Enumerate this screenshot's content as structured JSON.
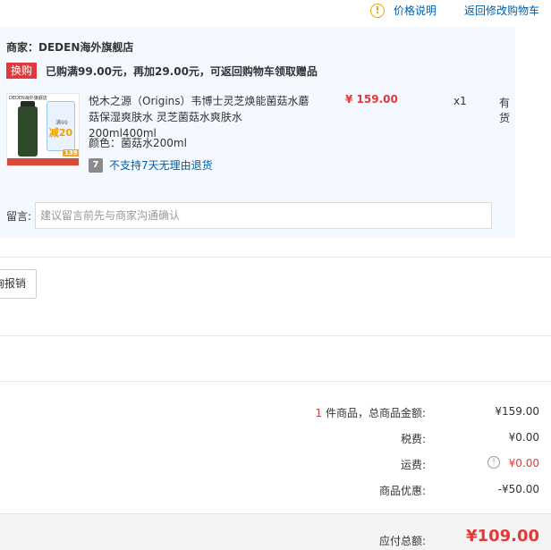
{
  "header": {
    "price_note": "价格说明",
    "back_link": "返回修改购物车"
  },
  "shop": {
    "name": "商家：DEDEN海外旗舰店",
    "promo_tag": "换购",
    "promo_text": "已购满99.00元，再加29.00元，可返回购物车领取赠品"
  },
  "product": {
    "title": "悦木之源（Origins）韦博士灵芝焕能菌菇水蘑菇保湿爽肤水 灵芝菌菇水爽肤水 200ml400ml",
    "price": "¥ 159.00",
    "qty": "x1",
    "stock": "有货",
    "color": "颜色：菌菇水200ml",
    "return_icon": "7",
    "return_text": "不支持7天无理由退货",
    "thumb": {
      "brand": "DEDEN海外旗舰店",
      "badge_man": "满99",
      "badge_jian": "减20",
      "price": "139"
    }
  },
  "remark": {
    "label": "留言:",
    "placeholder": "建议留言前先与商家沟通确认"
  },
  "report_button": "询报销",
  "summary": {
    "count": "1",
    "items_label": " 件商品，总商品金额:",
    "items_value": "¥159.00",
    "tax_label": "税费:",
    "tax_value": "¥0.00",
    "shipping_label": "运费:",
    "shipping_value": "¥0.00",
    "discount_label": "商品优惠:",
    "discount_value": "-¥50.00"
  },
  "total": {
    "label": "应付总额:",
    "value": "¥109.00"
  },
  "colors": {
    "accent_red": "#e4393c",
    "link_blue": "#005ea7",
    "shop_bg": "#f3f9ff"
  }
}
